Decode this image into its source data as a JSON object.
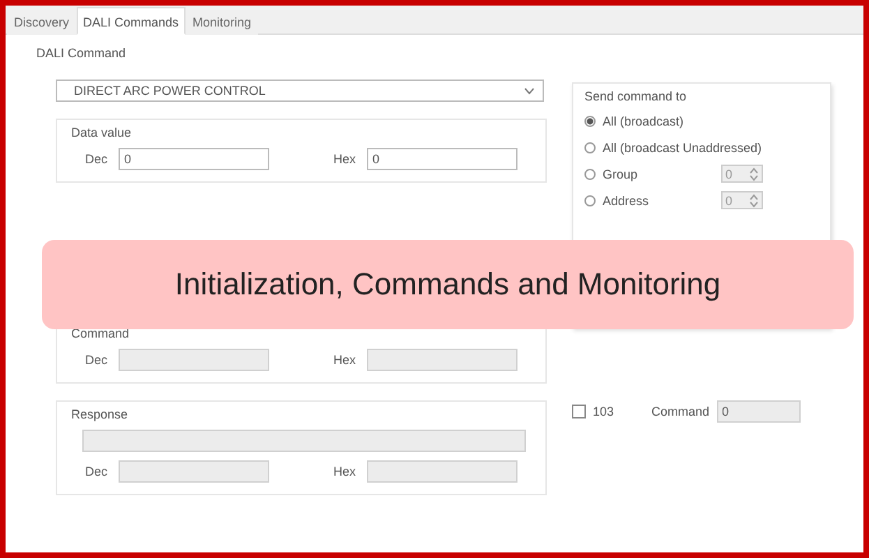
{
  "tabs": [
    {
      "label": "Discovery",
      "selected": false
    },
    {
      "label": "DALI Commands",
      "selected": true
    },
    {
      "label": "Monitoring",
      "selected": false
    }
  ],
  "dali_command": {
    "title": "DALI Command",
    "dropdown": {
      "value": "DIRECT ARC POWER CONTROL"
    }
  },
  "data_value": {
    "title": "Data value",
    "fields": [
      {
        "label": "Dec",
        "value": "0",
        "disabled": false
      },
      {
        "label": "Hex",
        "value": "0",
        "disabled": false
      }
    ]
  },
  "command": {
    "title": "Command",
    "fields": [
      {
        "label": "Dec",
        "disabled": true
      },
      {
        "label": "Hex",
        "disabled": true
      }
    ]
  },
  "response": {
    "title": "Response",
    "line": {
      "disabled": true
    },
    "fields": [
      {
        "label": "Dec",
        "disabled": true
      },
      {
        "label": "Hex",
        "disabled": true
      }
    ]
  },
  "send_to": {
    "title": "Send command to",
    "options": [
      {
        "label": "All (broadcast)",
        "selected": true
      },
      {
        "label": "All (broadcast Unaddressed)",
        "selected": false
      },
      {
        "label": "Group",
        "selected": false,
        "spinner": "0"
      },
      {
        "label": "Address",
        "selected": false,
        "spinner": "0"
      }
    ]
  },
  "bit_option": {
    "label": "103",
    "checked": false
  },
  "command_field": {
    "label": "Command",
    "value": "0",
    "disabled": true
  },
  "banner": {
    "text": "Initialization, Commands and Monitoring"
  }
}
